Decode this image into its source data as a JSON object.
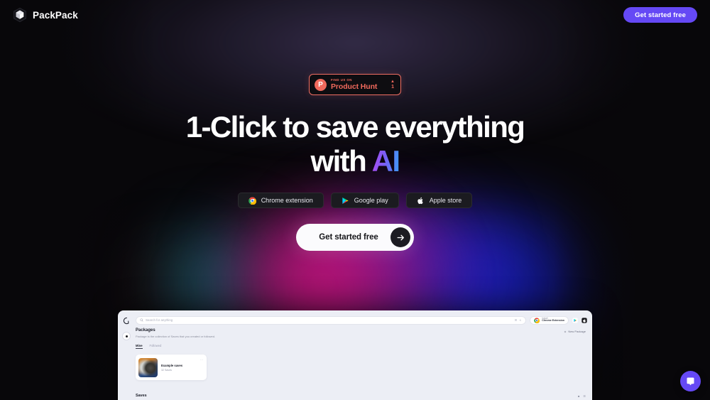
{
  "header": {
    "brand_name": "PackPack",
    "brand_icon": "cube-logo-icon",
    "cta_label": "Get started free"
  },
  "hero": {
    "product_hunt": {
      "logo_letter": "P",
      "kicker": "FIND US ON",
      "title": "Product Hunt",
      "caret": "▲",
      "count": "1"
    },
    "headline_line1": "1-Click to save everything",
    "headline_line2_prefix": "with ",
    "headline_line2_accent": "AI",
    "store_buttons": [
      {
        "label": "Chrome extension",
        "icon": "chrome-icon"
      },
      {
        "label": "Google play",
        "icon": "google-play-icon"
      },
      {
        "label": "Apple store",
        "icon": "apple-icon"
      }
    ],
    "cta_label": "Get started free",
    "cta_arrow_icon": "arrow-right-icon"
  },
  "app_preview": {
    "search_placeholder": "Search for anything",
    "search_shortcut": "⌘ K",
    "install_pill": {
      "small_label": "Install",
      "label": "Chrome Extension",
      "icon": "chrome-icon"
    },
    "store_icons": [
      "google-play-icon",
      "apple-icon"
    ],
    "new_package_label": "New Package",
    "new_package_icon": "plus-icon",
    "page_title": "Packages",
    "page_subtitle": "Package is the collection of Saves that you created or followed.",
    "tabs": [
      {
        "label": "Mine",
        "active": true
      },
      {
        "label": "Followed",
        "active": false
      }
    ],
    "package_card": {
      "name": "Example saves",
      "meta": "32 Saves",
      "menu_icon": "more-horizontal-icon"
    },
    "saves_title": "Saves",
    "saves_actions": [
      "grid-view-icon",
      "list-view-icon"
    ]
  },
  "chat": {
    "icon": "chat-bubble-icon"
  },
  "colors": {
    "accent_purple": "#6549f5",
    "product_hunt": "#f0695c",
    "background": "#08070a",
    "gradient_pink": "#f5128c",
    "gradient_blue": "#1e26f5",
    "gradient_teal": "#18aaaf",
    "app_bg": "#eceef5"
  }
}
